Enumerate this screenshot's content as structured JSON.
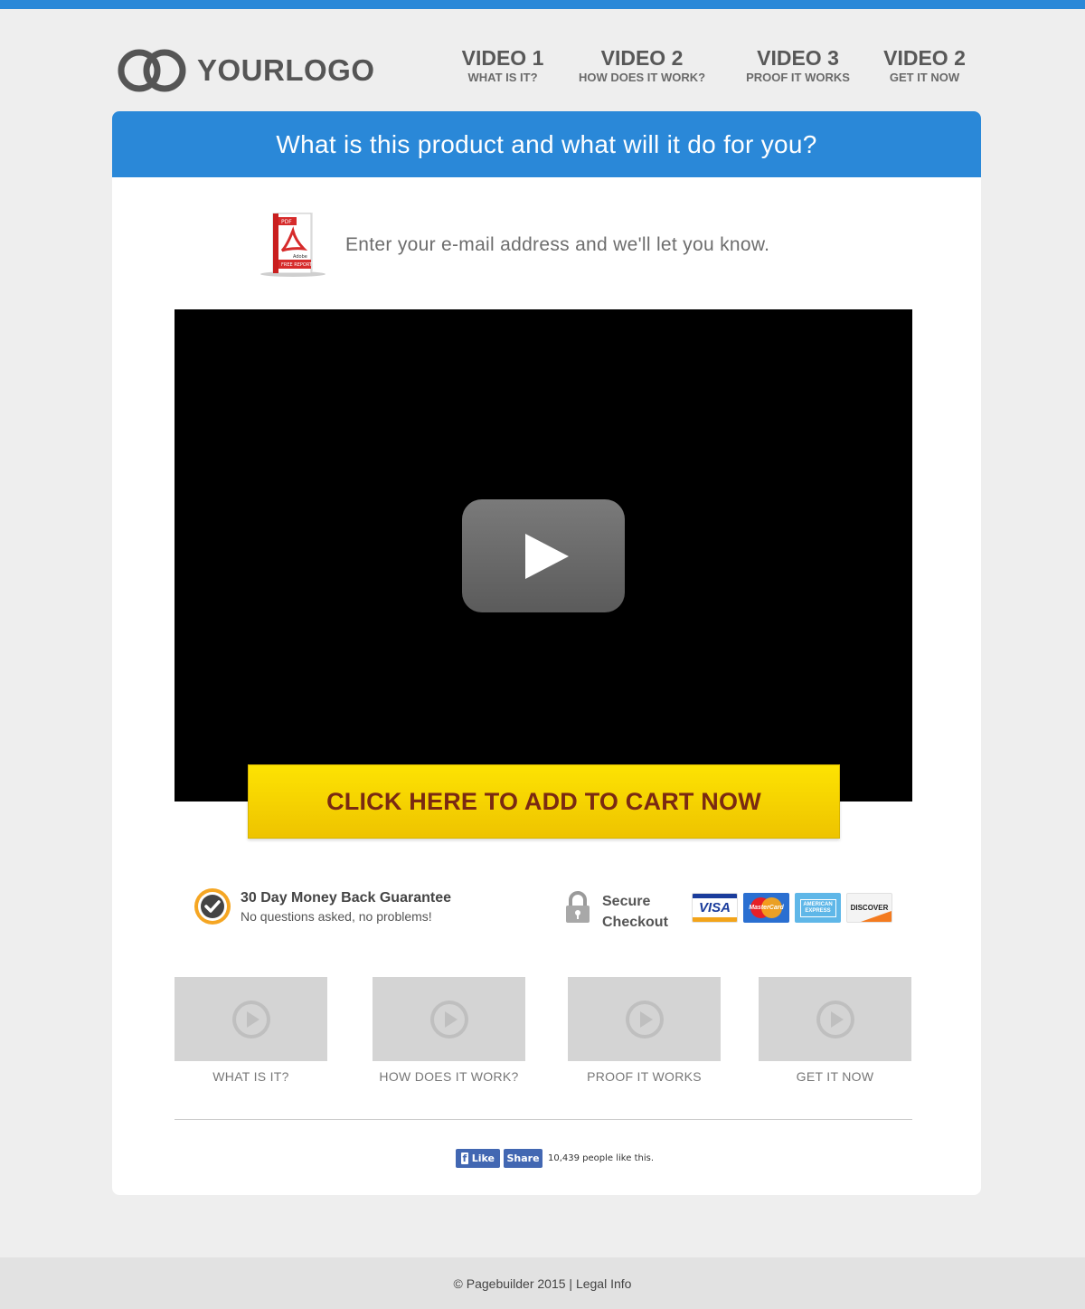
{
  "brand": {
    "logo_text": "YOURLOGO",
    "accent": "#2a88d8",
    "cta_color": "#fde302",
    "cta_text_color": "#7a2a12"
  },
  "nav": [
    {
      "title": "VIDEO 1",
      "subtitle": "WHAT IS IT?"
    },
    {
      "title": "VIDEO 2",
      "subtitle": "HOW DOES IT WORK?"
    },
    {
      "title": "VIDEO 3",
      "subtitle": "PROOF IT WORKS"
    },
    {
      "title": "VIDEO 2",
      "subtitle": "GET IT NOW"
    }
  ],
  "headline": "What is this product and what will it do for you?",
  "optin": {
    "text": "Enter your e-mail address and we'll let you know.",
    "report_badge": "PDF",
    "report_brand": "Adobe",
    "report_label": "FREE REPORT"
  },
  "video": {
    "play_icon": "play-icon"
  },
  "cta": {
    "label": "CLICK HERE TO ADD TO CART NOW"
  },
  "guarantee": {
    "title": "30 Day Money Back Guarantee",
    "subtitle": "No questions asked, no problems!"
  },
  "secure": {
    "line1": "Secure",
    "line2": "Checkout"
  },
  "payment_cards": [
    "VISA",
    "MasterCard",
    "AMERICAN EXPRESS",
    "DISCOVER"
  ],
  "thumbnails": [
    {
      "label": "WHAT IS IT?"
    },
    {
      "label": "HOW DOES IT WORK?"
    },
    {
      "label": "PROOF IT WORKS"
    },
    {
      "label": "GET IT NOW"
    }
  ],
  "social": {
    "like_label": "Like",
    "share_label": "Share",
    "count_text": "10,439 people like this."
  },
  "footer": {
    "copyright": "© Pagebuilder 2015",
    "separator": "|",
    "legal_link": "Legal Info"
  }
}
